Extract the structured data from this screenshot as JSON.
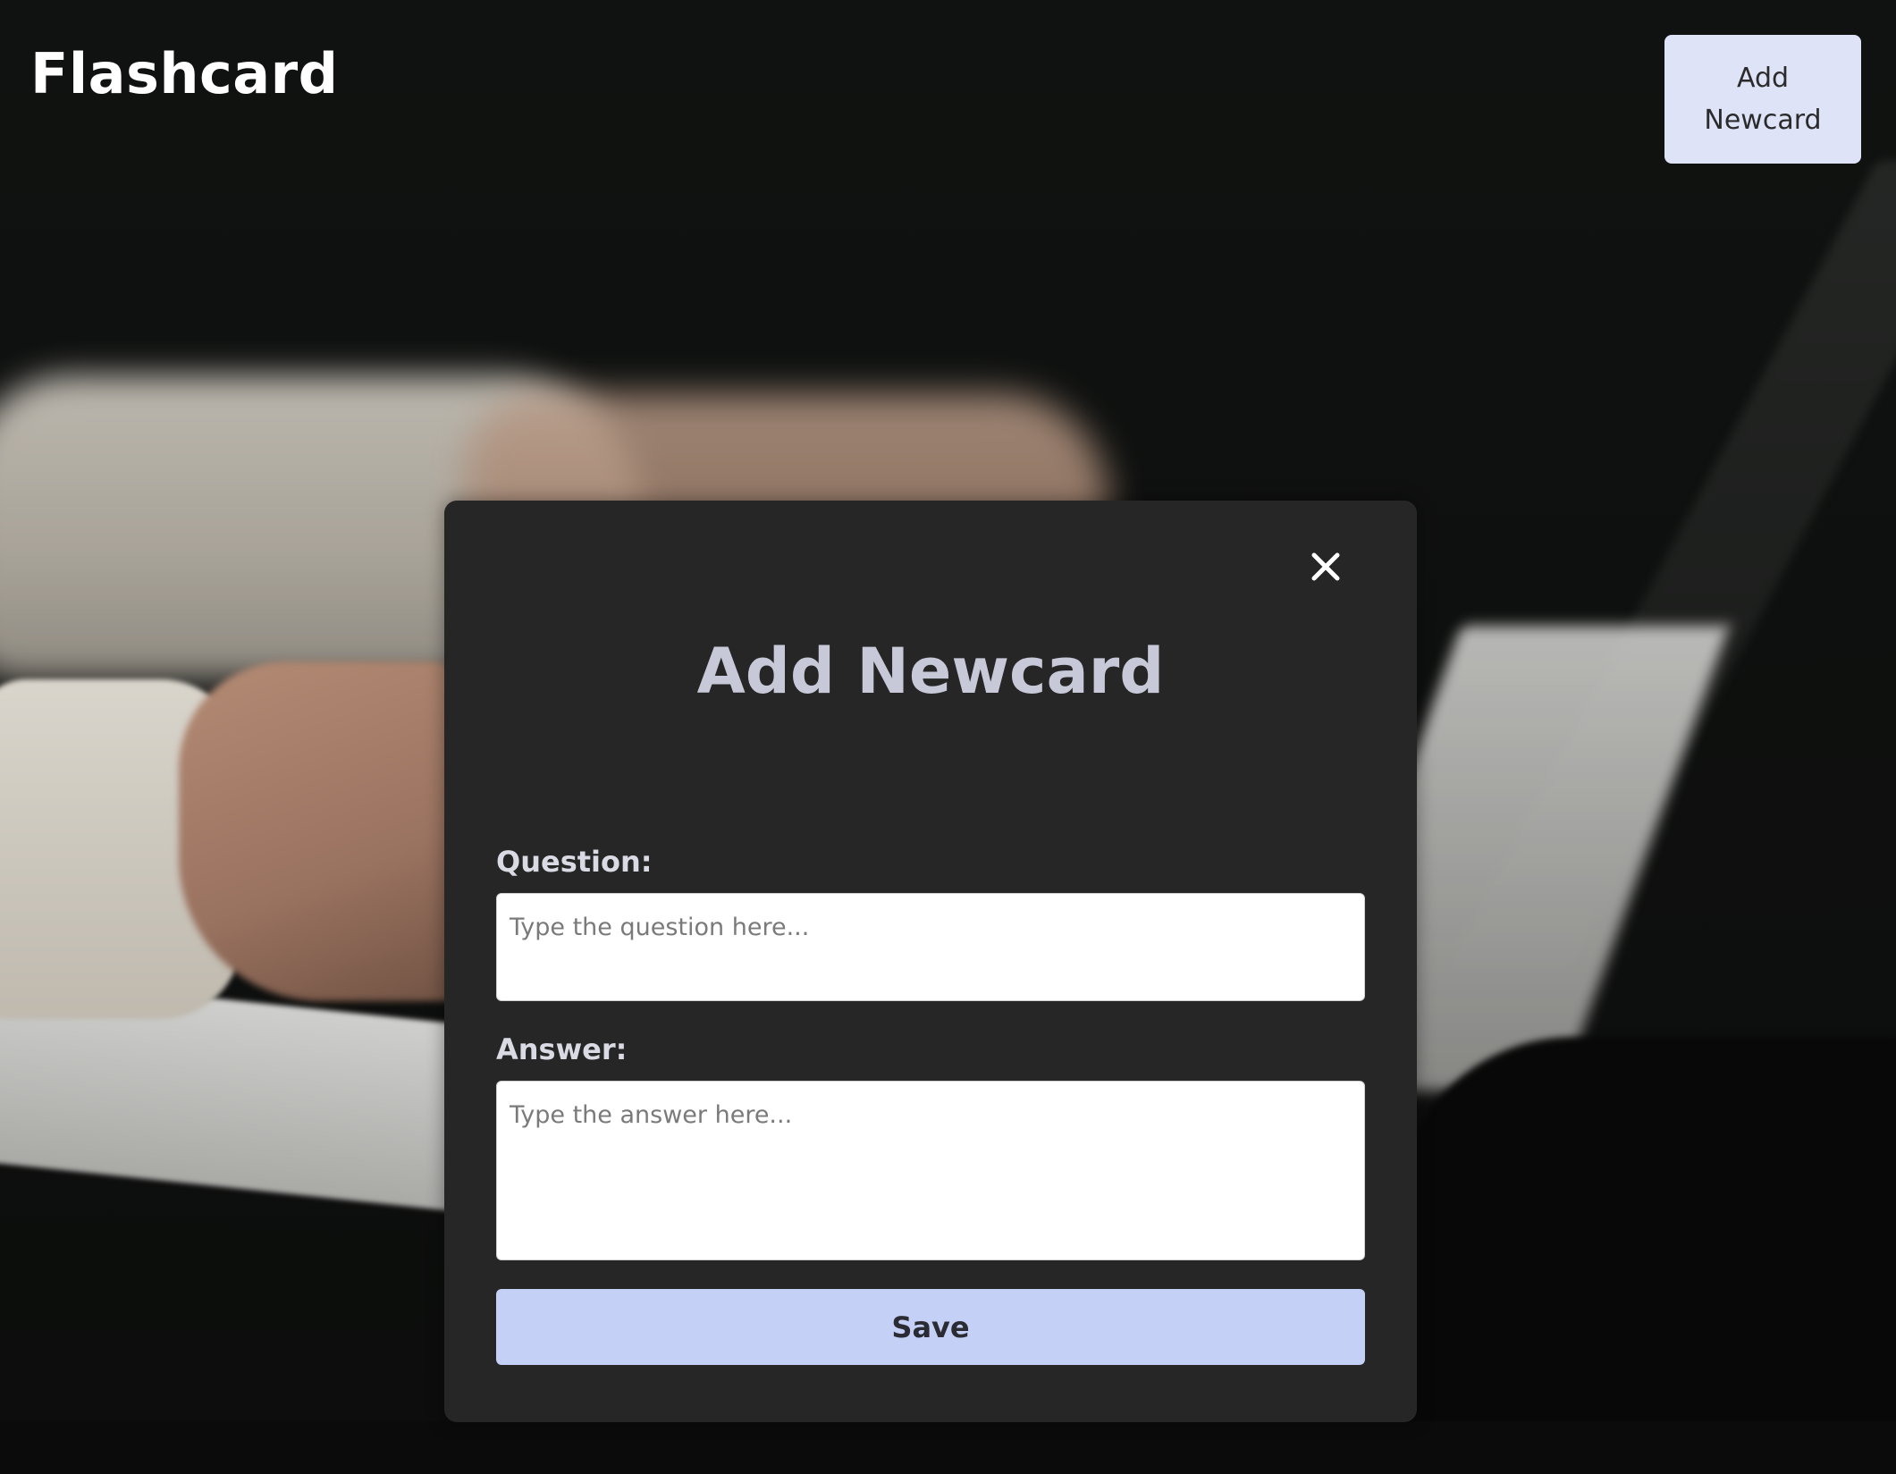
{
  "header": {
    "brand": "Flashcard",
    "add_button_line1": "Add",
    "add_button_line2": "Newcard"
  },
  "modal": {
    "title": "Add Newcard",
    "close_icon": "close-icon",
    "question_label": "Question:",
    "question_placeholder": "Type the question here...",
    "question_value": "",
    "answer_label": "Answer:",
    "answer_placeholder": "Type the answer here...",
    "answer_value": "",
    "save_label": "Save"
  },
  "colors": {
    "modal_background": "#262626",
    "add_button": "#dfe3f7",
    "save_button": "#c5d0f6",
    "title_text": "#c7c9d8"
  }
}
